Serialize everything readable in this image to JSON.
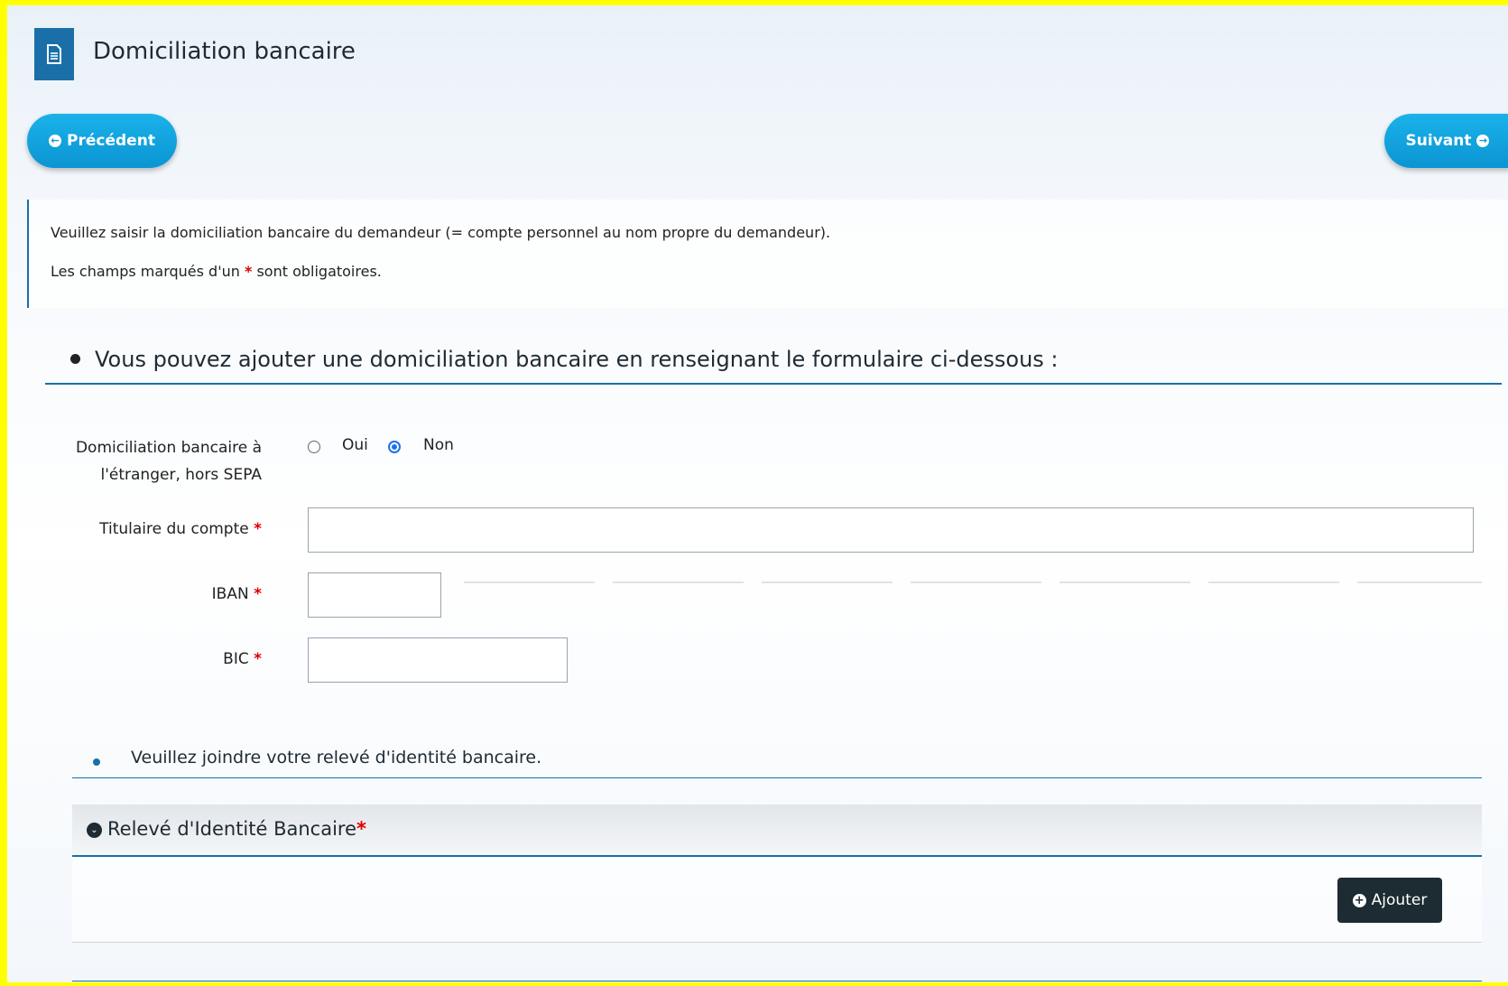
{
  "header": {
    "title": "Domiciliation bancaire",
    "icon": "document-icon"
  },
  "nav": {
    "previous_label": "Précédent",
    "next_label": "Suivant"
  },
  "info": {
    "line1": "Veuillez saisir la domiciliation bancaire du demandeur (= compte personnel au nom propre du demandeur).",
    "line2_prefix": "Les champs marqués d'un ",
    "line2_star": "*",
    "line2_suffix": " sont obligatoires."
  },
  "section": {
    "heading": "Vous pouvez ajouter une domiciliation bancaire en renseignant le formulaire ci-dessous :"
  },
  "form": {
    "foreign_label_line1": "Domiciliation bancaire à",
    "foreign_label_line2": "l'étranger, hors SEPA",
    "option_yes": "Oui",
    "option_no": "Non",
    "selected_option": "Non",
    "holder_label": "Titulaire du compte",
    "holder_value": "",
    "iban_label": "IBAN",
    "iban_value": "",
    "bic_label": "BIC",
    "bic_value": "",
    "required_mark": "*"
  },
  "attachment": {
    "instruction": "Veuillez joindre votre relevé d'identité bancaire.",
    "panel_title": "Relevé d'Identité Bancaire",
    "required_mark": "*",
    "add_label": "Ajouter"
  },
  "colors": {
    "accent": "#1a6fa8",
    "button": "#0b95d2",
    "dark_button": "#1d2b33",
    "required": "#dd0000",
    "border_highlight": "#ffff00"
  }
}
